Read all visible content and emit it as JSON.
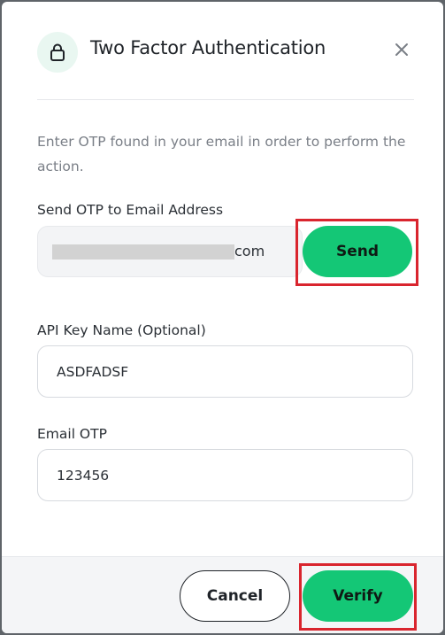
{
  "dialog": {
    "title": "Two Factor Authentication",
    "icon": "lock-icon",
    "close_icon": "close-icon",
    "description": "Enter OTP found in your email in order to perform the action."
  },
  "email_section": {
    "label": "Send OTP to Email Address",
    "email_suffix": "com",
    "send_label": "Send"
  },
  "api_key": {
    "label": "API Key Name (Optional)",
    "value": "ASDFADSF"
  },
  "otp": {
    "label": "Email OTP",
    "value": "123456"
  },
  "footer": {
    "cancel_label": "Cancel",
    "verify_label": "Verify"
  },
  "colors": {
    "accent": "#14c776",
    "highlight": "#d9252e",
    "icon_bg": "#e9f7f1"
  }
}
